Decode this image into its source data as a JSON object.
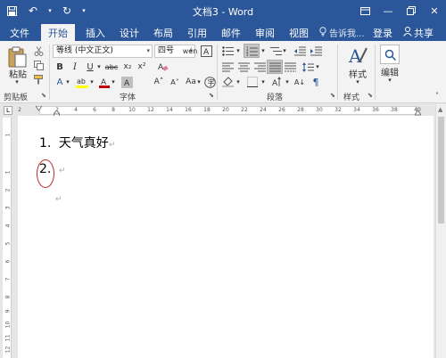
{
  "titlebar": {
    "title": "文档3 - Word",
    "qat": [
      "save-icon",
      "undo-icon",
      "redo-icon"
    ],
    "controls": [
      "ribbon-display-icon",
      "minimize-icon",
      "restore-icon",
      "close-icon"
    ]
  },
  "tabs": [
    {
      "label": "文件",
      "active": false
    },
    {
      "label": "开始",
      "active": true
    },
    {
      "label": "插入",
      "active": false
    },
    {
      "label": "设计",
      "active": false
    },
    {
      "label": "布局",
      "active": false
    },
    {
      "label": "引用",
      "active": false
    },
    {
      "label": "邮件",
      "active": false
    },
    {
      "label": "审阅",
      "active": false
    },
    {
      "label": "视图",
      "active": false
    }
  ],
  "tellme": "告诉我...",
  "login": "登录",
  "share": "共享",
  "ribbon": {
    "clipboard": {
      "paste_label": "粘贴",
      "group_label": "剪贴板"
    },
    "font": {
      "font_name": "等线 (中文正文)",
      "font_size": "四号",
      "group_label": "字体"
    },
    "paragraph": {
      "group_label": "段落"
    },
    "styles": {
      "button_label": "样式",
      "group_label": "样式"
    },
    "editing": {
      "button_label": "编辑"
    }
  },
  "ruler": {
    "numbers": [
      "2",
      "2",
      "4",
      "6",
      "8",
      "10",
      "12",
      "14",
      "16",
      "18",
      "20",
      "22",
      "24",
      "26",
      "28",
      "30",
      "32",
      "34",
      "36",
      "38",
      "40"
    ]
  },
  "vruler": {
    "numbers": [
      "1",
      "1",
      "2",
      "3",
      "4",
      "5",
      "6",
      "7",
      "8",
      "9",
      "10",
      "11",
      "12",
      "13"
    ]
  },
  "document": {
    "line1_number": "1.",
    "line1_text": "天气真好",
    "line2_number": "2.",
    "para_mark": "↵"
  },
  "colors": {
    "brand": "#2b579a",
    "highlight": "#ffff00",
    "font_color": "#c00000",
    "annotation": "#c0292b"
  }
}
